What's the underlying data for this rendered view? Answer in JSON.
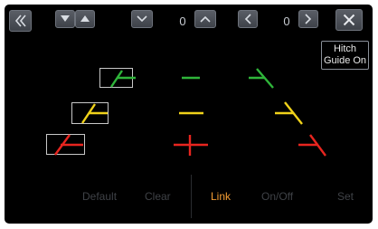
{
  "toolbar": {
    "left_counter": "0",
    "right_counter": "0"
  },
  "hitch_guide": {
    "line1": "Hitch",
    "line2": "Guide On"
  },
  "bottom_bar": {
    "default": "Default",
    "clear": "Clear",
    "link": "Link",
    "onoff": "On/Off",
    "set": "Set"
  },
  "colors": {
    "green": "#2fb53a",
    "yellow": "#f0d21a",
    "red": "#e8251f",
    "active_orange": "#f29c33",
    "inactive_gray": "#3f4247"
  },
  "icons": {
    "back": "double-chevron-left-icon",
    "down_filled": "triangle-down-icon",
    "up_filled": "triangle-up-icon",
    "chevron_down": "chevron-down-icon",
    "chevron_up": "chevron-up-icon",
    "chevron_left": "chevron-left-icon",
    "chevron_right": "chevron-right-icon",
    "close": "close-icon"
  }
}
